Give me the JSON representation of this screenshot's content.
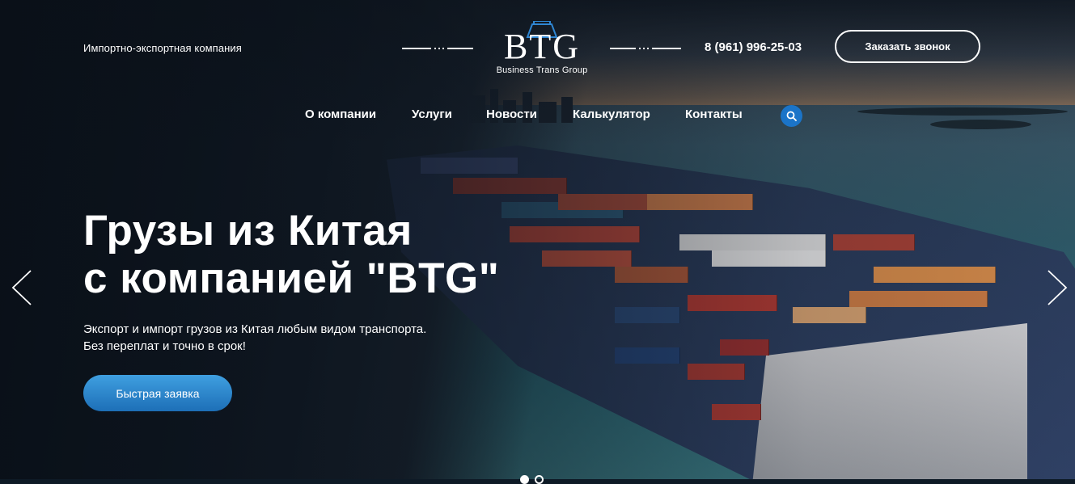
{
  "header": {
    "tagline": "Импортно-экспортная компания",
    "logo_mark": "BTG",
    "logo_sub": "Business Trans Group",
    "phone": "8 (961) 996-25-03",
    "callback_button": "Заказать звонок"
  },
  "nav": {
    "items": [
      {
        "label": "О компании"
      },
      {
        "label": "Услуги"
      },
      {
        "label": "Новости"
      },
      {
        "label": "Калькулятор"
      },
      {
        "label": "Контакты"
      }
    ],
    "search_icon": "search-icon"
  },
  "hero": {
    "title_line1": "Грузы из Китая",
    "title_line2": "с компанией \"BTG\"",
    "subtitle_line1": "Экспорт и импорт грузов из Китая любым видом транспорта.",
    "subtitle_line2": "Без переплат и точно в срок!",
    "cta_button": "Быстрая заявка"
  },
  "slider": {
    "prev_icon": "chevron-left-icon",
    "next_icon": "chevron-right-icon",
    "active_slide": 1,
    "slide_count": 2
  },
  "colors": {
    "accent": "#1b74c8",
    "cta_gradient_top": "#3f9fe0",
    "cta_gradient_bottom": "#1d6fb7",
    "text": "#ffffff"
  }
}
